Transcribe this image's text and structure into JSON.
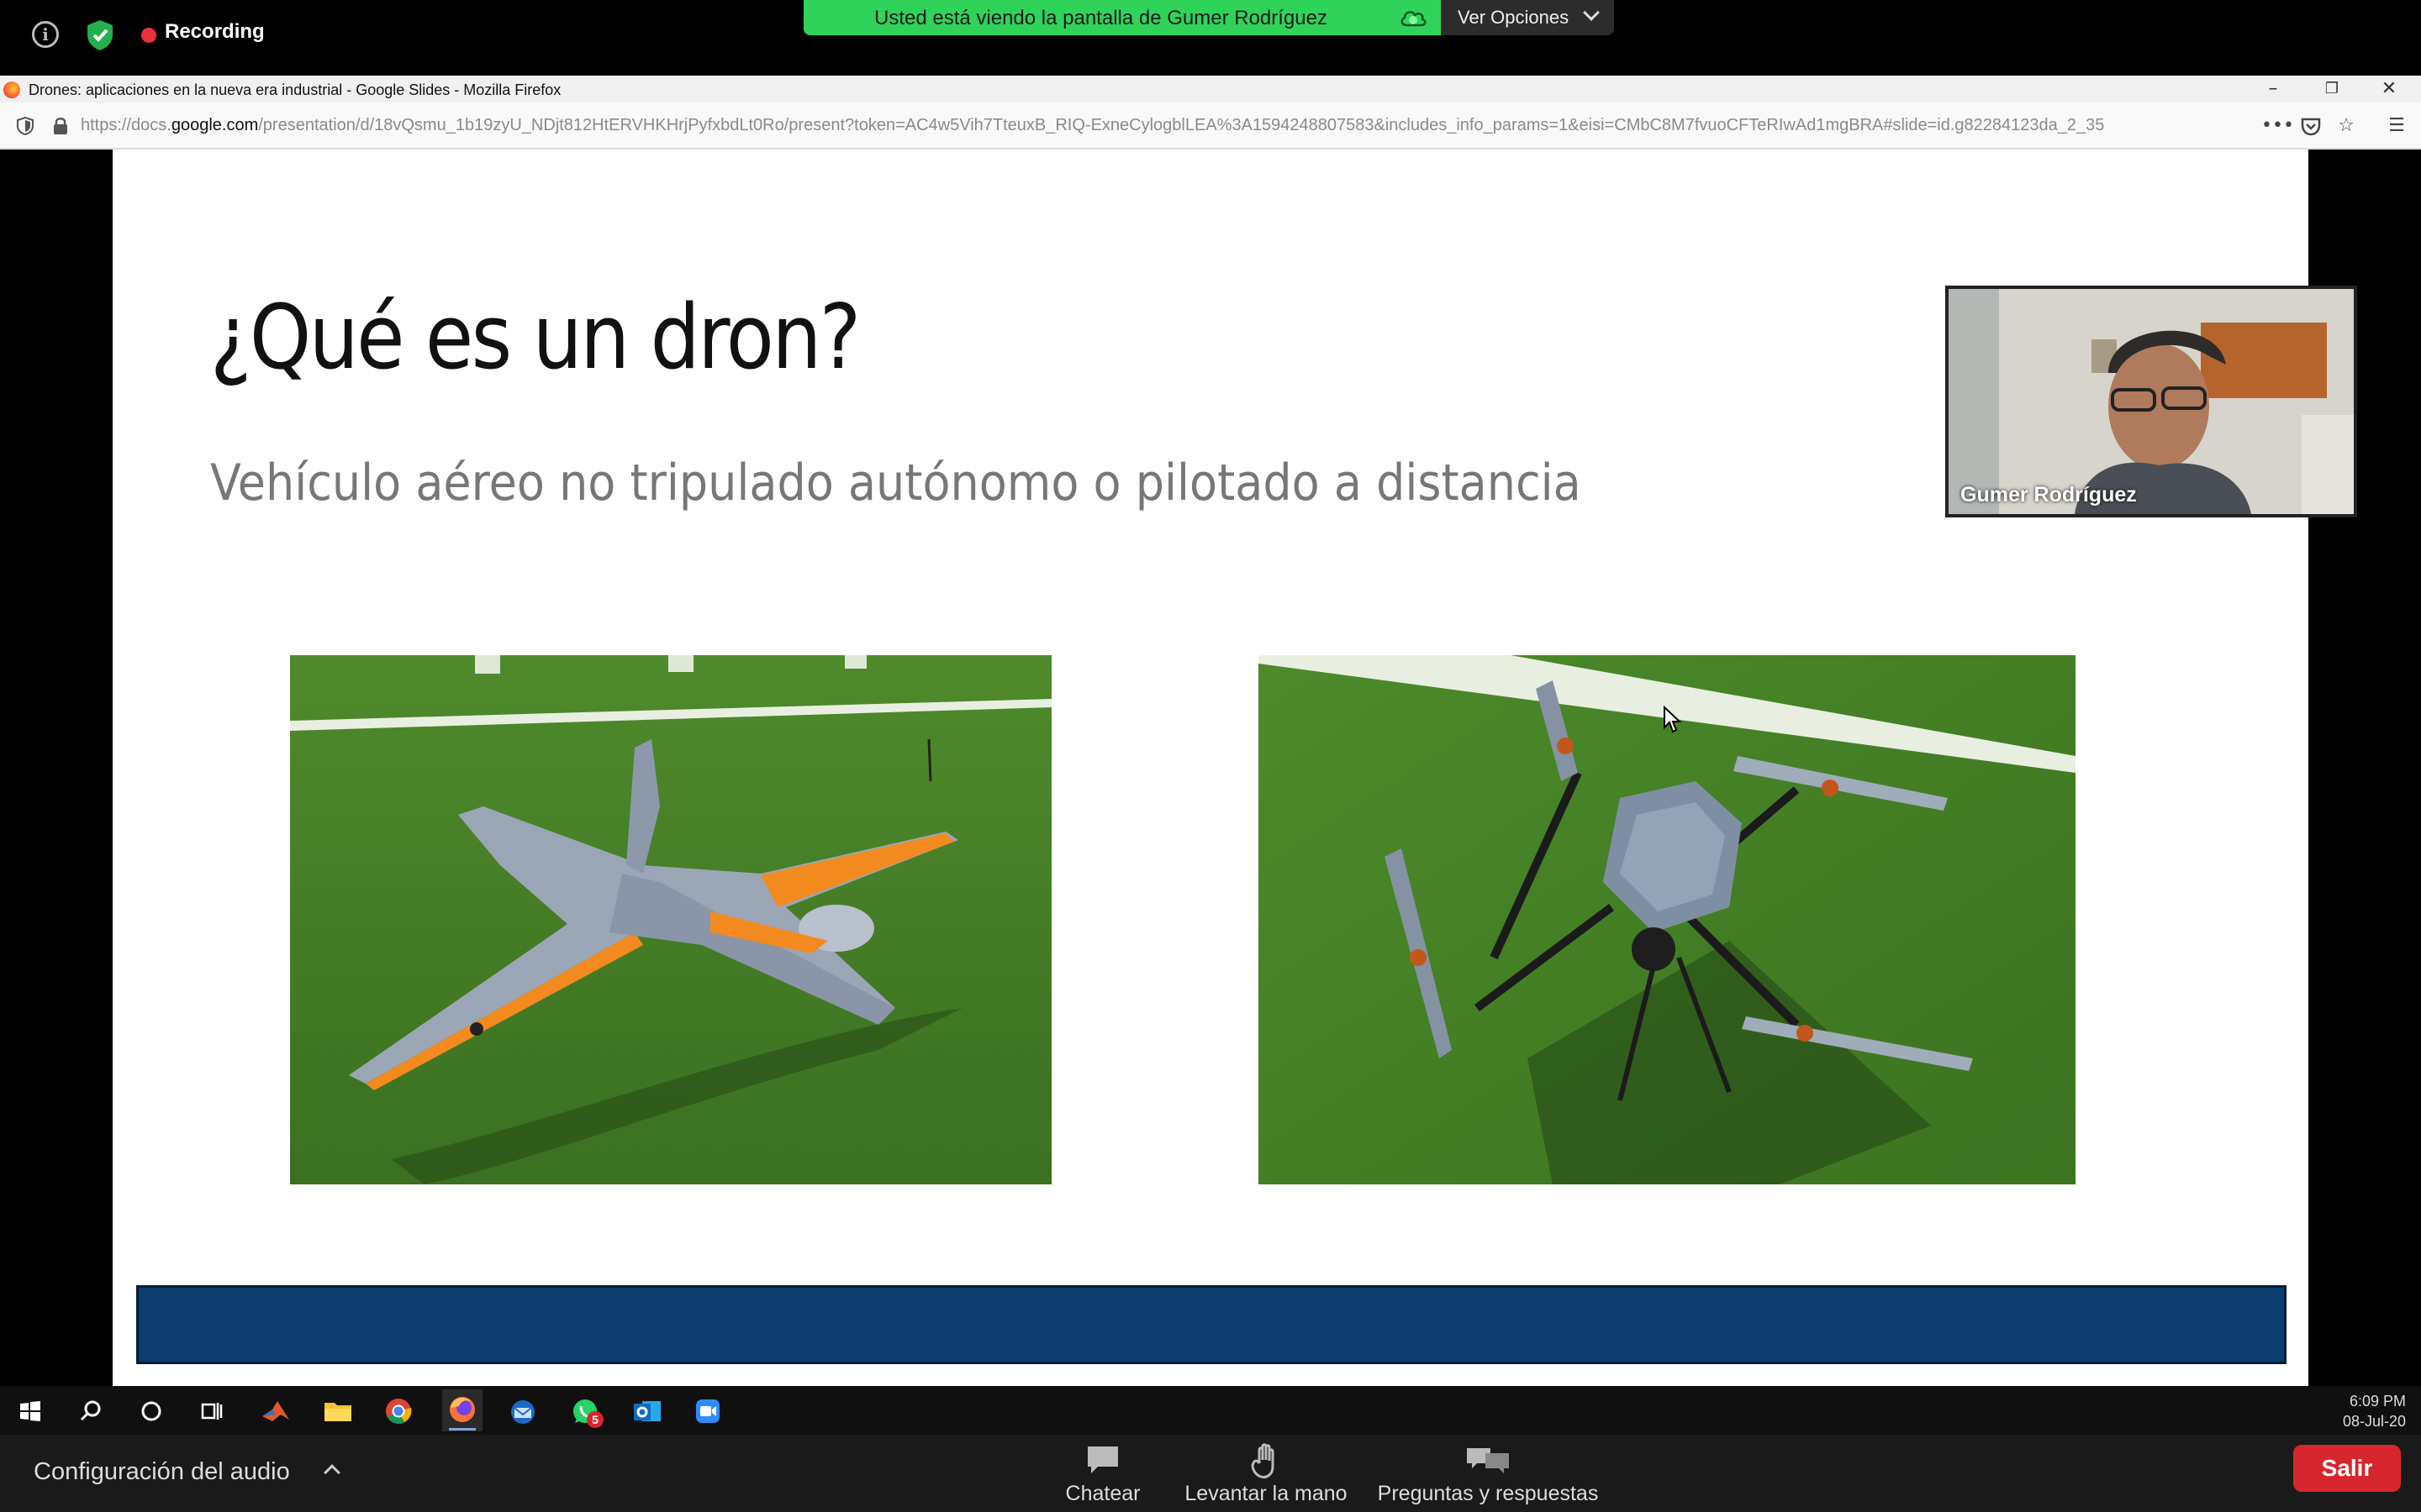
{
  "zoom": {
    "recording_label": "Recording",
    "share_banner": "Usted está viendo la pantalla de Gumer Rodríguez",
    "view_options": "Ver Opciones",
    "audio_config": "Configuración del audio",
    "buttons": {
      "chat": "Chatear",
      "raise_hand": "Levantar la mano",
      "qa": "Preguntas y respuestas",
      "leave": "Salir"
    },
    "presenter_name": "Gumer Rodríguez",
    "colors": {
      "banner_green": "#2fd35a",
      "recording_red": "#e8323c",
      "leave_red": "#d7262e"
    }
  },
  "browser": {
    "window_title": "Drones: aplicaciones en la nueva era industrial - Google Slides - Mozilla Firefox",
    "url_prefix": "https://docs.",
    "url_domain": "google.com",
    "url_rest": "/presentation/d/18vQsmu_1b19zyU_NDjt812HtERVHKHrjPyfxbdLt0Ro/present?token=AC4w5Vih7TteuxB_RIQ-ExneCylogblLEA%3A1594248807583&includes_info_params=1&eisi=CMbC8M7fvuoCFTeRIwAd1mgBRA#slide=id.g82284123da_2_35"
  },
  "slide": {
    "title": "¿Qué es un dron?",
    "subtitle": "Vehículo aéreo no tripulado autónomo o pilotado a distancia",
    "footer_color": "#0c3d6e"
  },
  "taskbar": {
    "time": "6:09 PM",
    "date": "08-Jul-20",
    "whatsapp_badge": "5",
    "apps": [
      "windows-start",
      "search",
      "cortana",
      "task-view",
      "matlab",
      "file-explorer",
      "chrome",
      "firefox",
      "thunderbird",
      "whatsapp",
      "outlook",
      "zoom"
    ]
  }
}
